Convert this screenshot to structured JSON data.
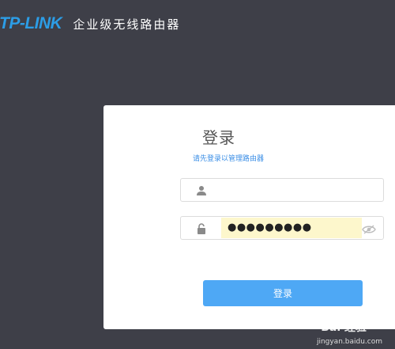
{
  "header": {
    "logo_text": "TP-LINK",
    "subtitle": "企业级无线路由器"
  },
  "login": {
    "title": "登录",
    "subtitle": "请先登录以管理路由器",
    "username": {
      "value": "",
      "icon": "user-icon"
    },
    "password": {
      "value": "●●●●●●●●●",
      "icon": "lock-icon",
      "toggle_icon": "eye-slash-icon"
    },
    "button_label": "登录"
  },
  "watermark": {
    "text": "Bai 经验",
    "url": "jingyan.baidu.com"
  },
  "colors": {
    "background": "#3e3f48",
    "brand": "#2c9de6",
    "button": "#4ea8f5",
    "autofill": "#fdf7cc"
  }
}
